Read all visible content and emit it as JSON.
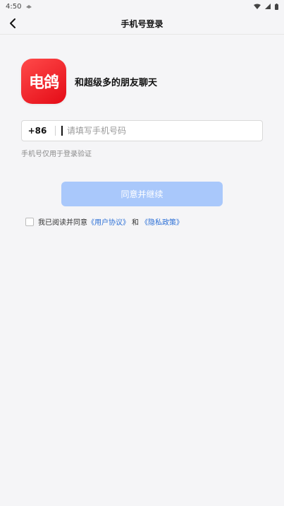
{
  "status_bar": {
    "time": "4:50",
    "icons": [
      "notification-icon",
      "wifi-icon",
      "signal-icon",
      "battery-icon"
    ]
  },
  "header": {
    "title": "手机号登录",
    "back_icon": "chevron-left-icon"
  },
  "brand": {
    "logo_text": "电鸽",
    "tagline": "和超级多的朋友聊天",
    "logo_color": "#f52a2a"
  },
  "phone": {
    "country_code": "+86",
    "placeholder": "请填写手机号码",
    "value": "",
    "hint": "手机号仅用于登录验证"
  },
  "agree_button": {
    "label": "同意并继续",
    "color": "#a9c8fb"
  },
  "terms": {
    "prefix": "我已阅读并同意",
    "user_agreement": "《用户协议》",
    "and": "和",
    "privacy_policy": "《隐私政策》",
    "checked": false,
    "link_color": "#2b6fd6"
  }
}
